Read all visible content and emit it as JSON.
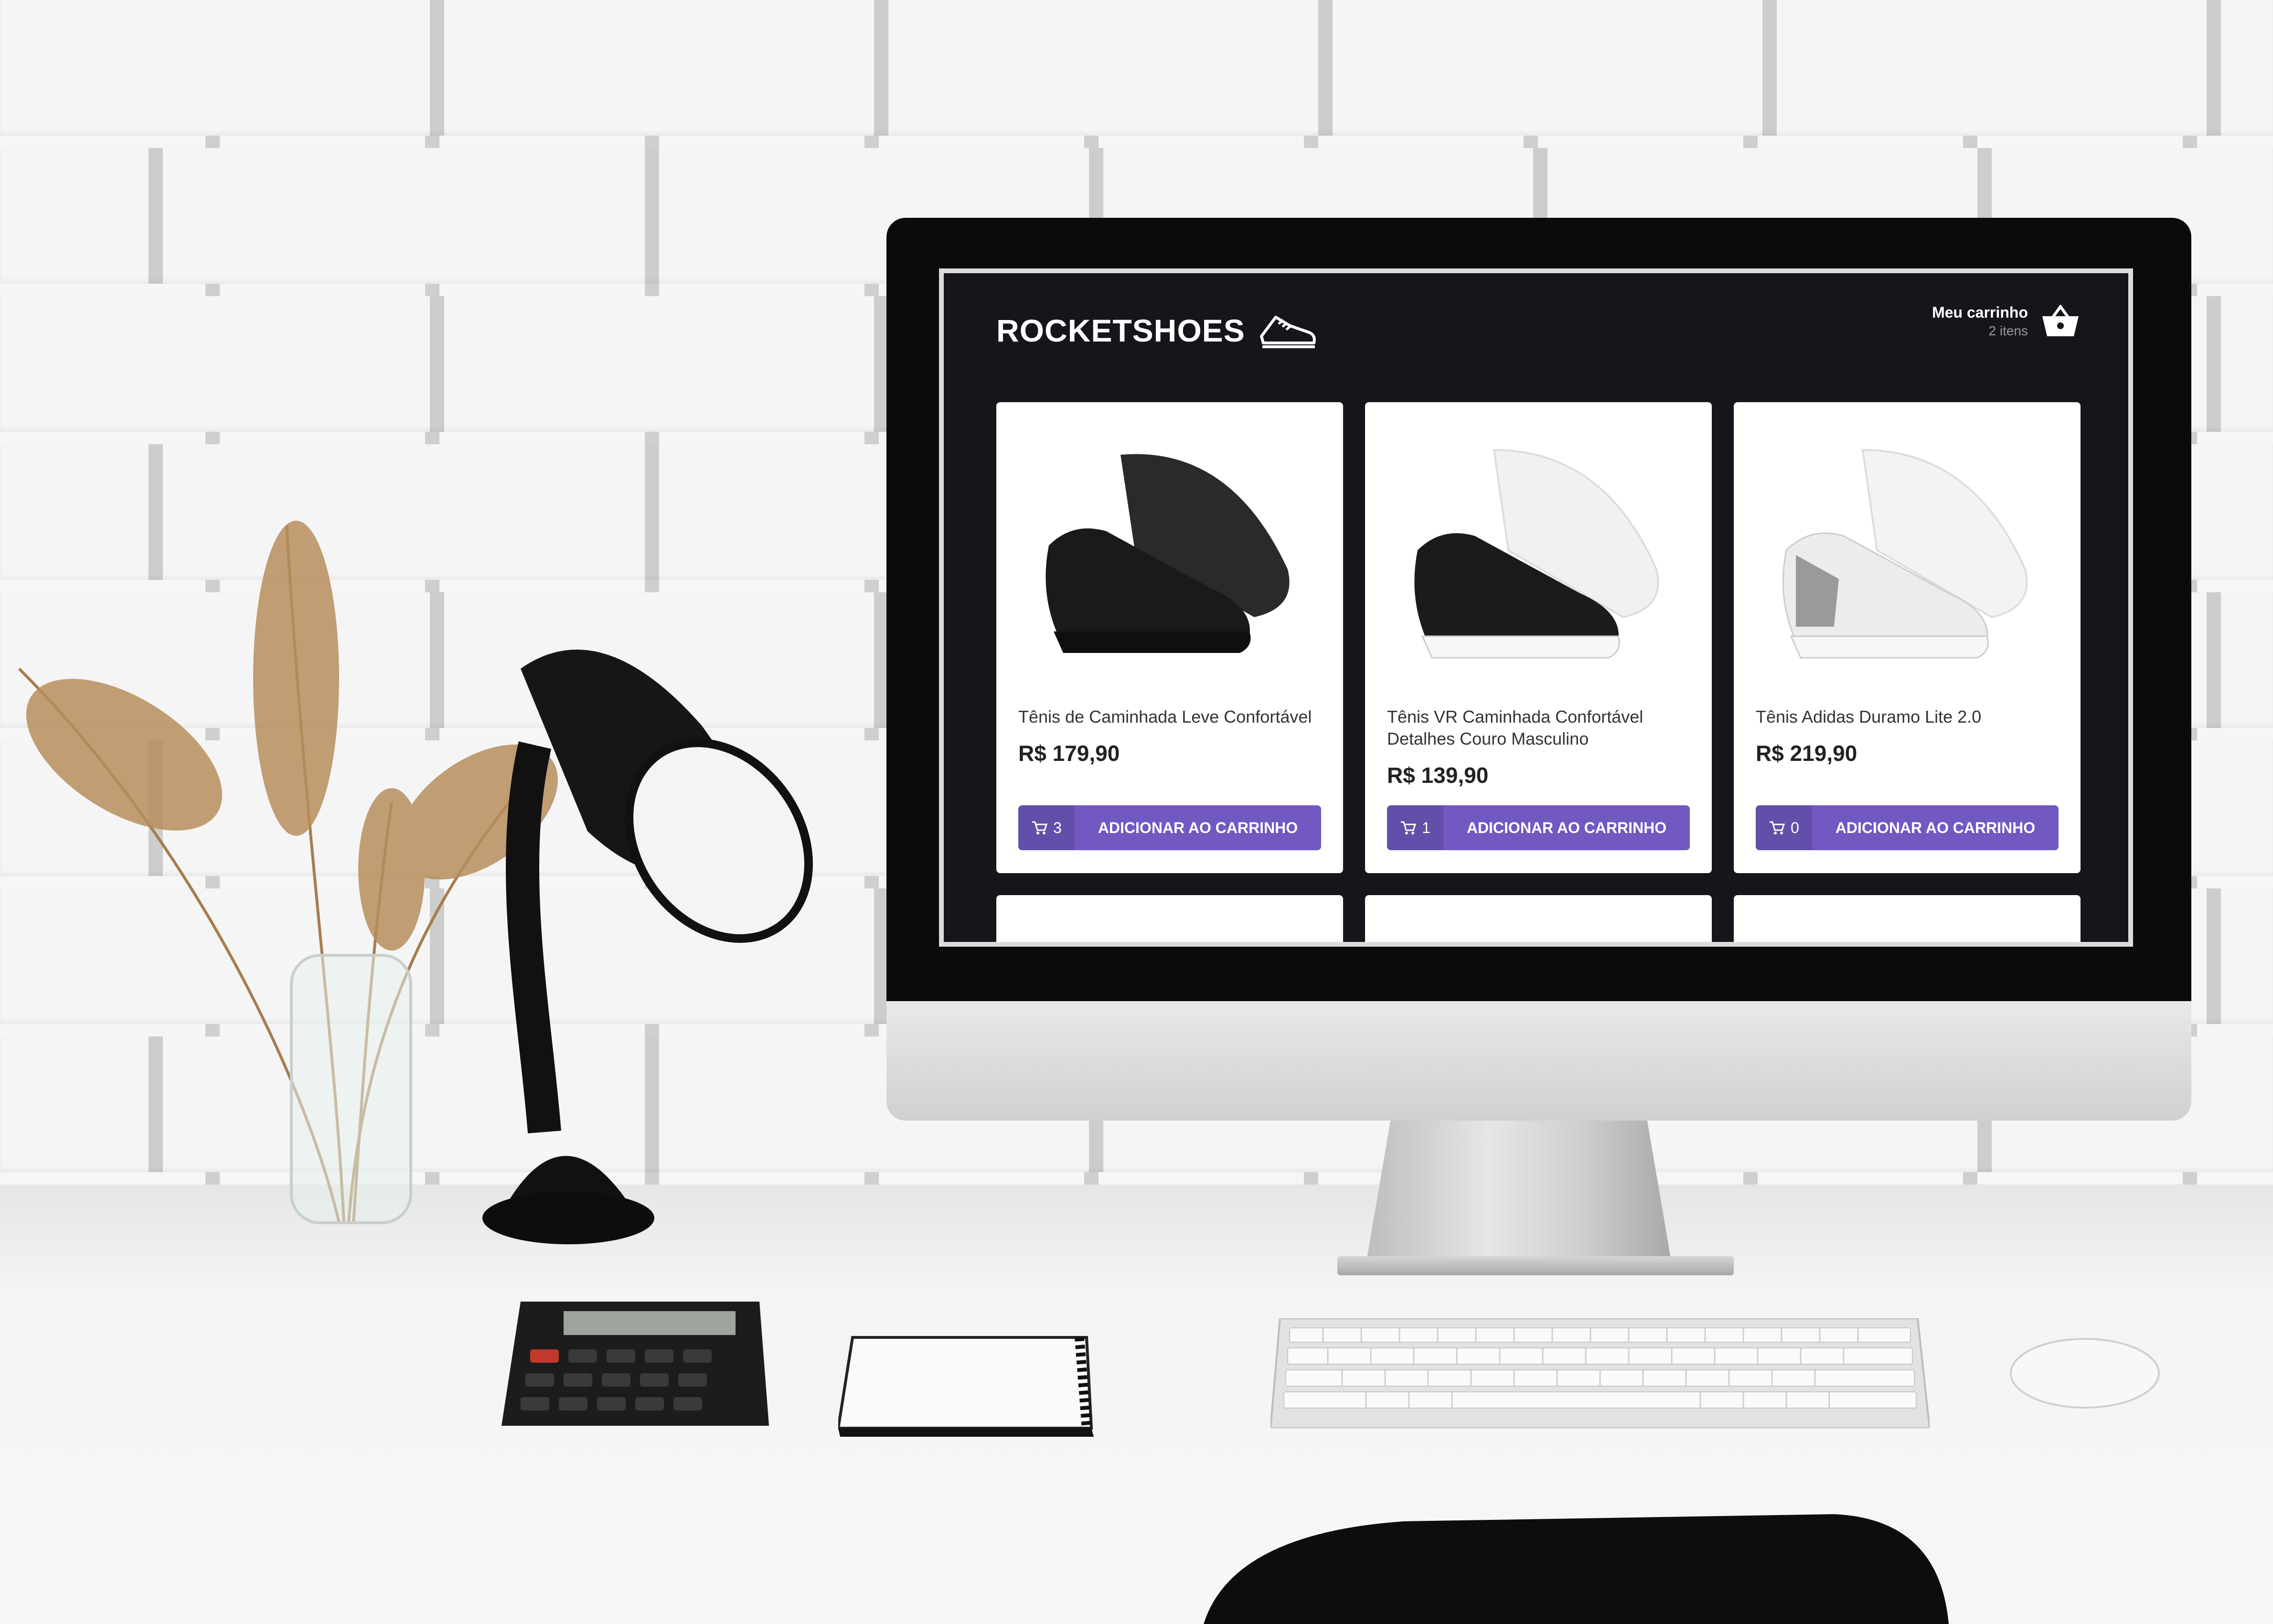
{
  "store": {
    "logo_text": "ROCKETSHOES",
    "cart": {
      "title": "Meu carrinho",
      "count": "2 itens"
    }
  },
  "products": [
    {
      "name": "Tênis de Caminhada Leve Confortável",
      "price": "R$ 179,90",
      "qty": "3",
      "button": "ADICIONAR AO CARRINHO",
      "shoe_color": "black"
    },
    {
      "name": "Tênis VR Caminhada Confortável Detalhes Couro Masculino",
      "price": "R$ 139,90",
      "qty": "1",
      "button": "ADICIONAR AO CARRINHO",
      "shoe_color": "black-white"
    },
    {
      "name": "Tênis Adidas Duramo Lite 2.0",
      "price": "R$ 219,90",
      "qty": "0",
      "button": "ADICIONAR AO CARRINHO",
      "shoe_color": "white-gray"
    }
  ],
  "colors": {
    "background": "#16151b",
    "accent": "#7159c1",
    "card": "#ffffff"
  },
  "icons": {
    "logo": "sneaker-icon",
    "cart": "shopping-basket-icon",
    "button": "add-shopping-cart-icon"
  }
}
